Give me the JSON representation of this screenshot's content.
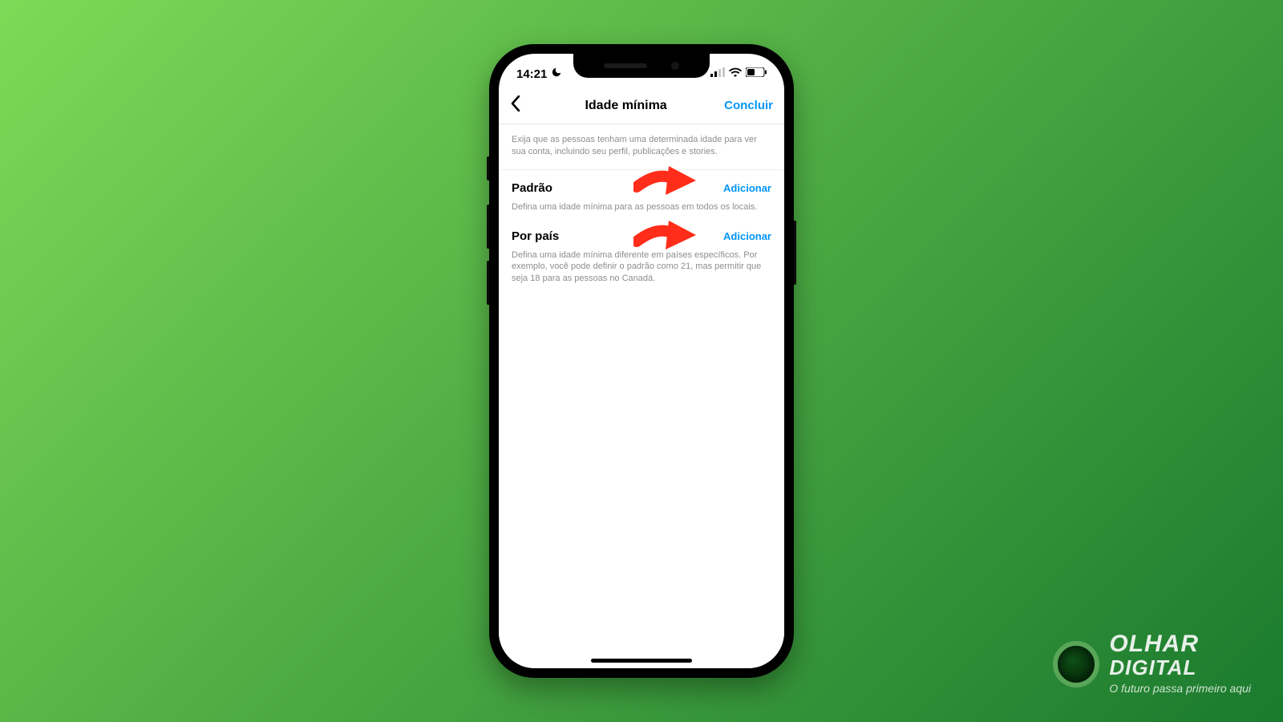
{
  "status": {
    "time": "14:21"
  },
  "nav": {
    "title": "Idade mínima",
    "done": "Concluir"
  },
  "intro": "Exija que as pessoas tenham uma determinada idade para ver sua conta, incluindo seu perfil, publicações e stories.",
  "sections": [
    {
      "title": "Padrão",
      "action": "Adicionar",
      "desc": "Defina uma idade mínima para as pessoas em todos os locais."
    },
    {
      "title": "Por país",
      "action": "Adicionar",
      "desc": "Defina uma idade mínima diferente em países específicos. Por exemplo, você pode definir o padrão como 21, mas permitir que seja 18 para as pessoas no Canadá."
    }
  ],
  "brand": {
    "line1": "OLHAR",
    "line2": "DIGITAL",
    "tagline": "O futuro passa primeiro aqui"
  },
  "colors": {
    "accent": "#0095f6",
    "arrow": "#ff2d1a"
  }
}
